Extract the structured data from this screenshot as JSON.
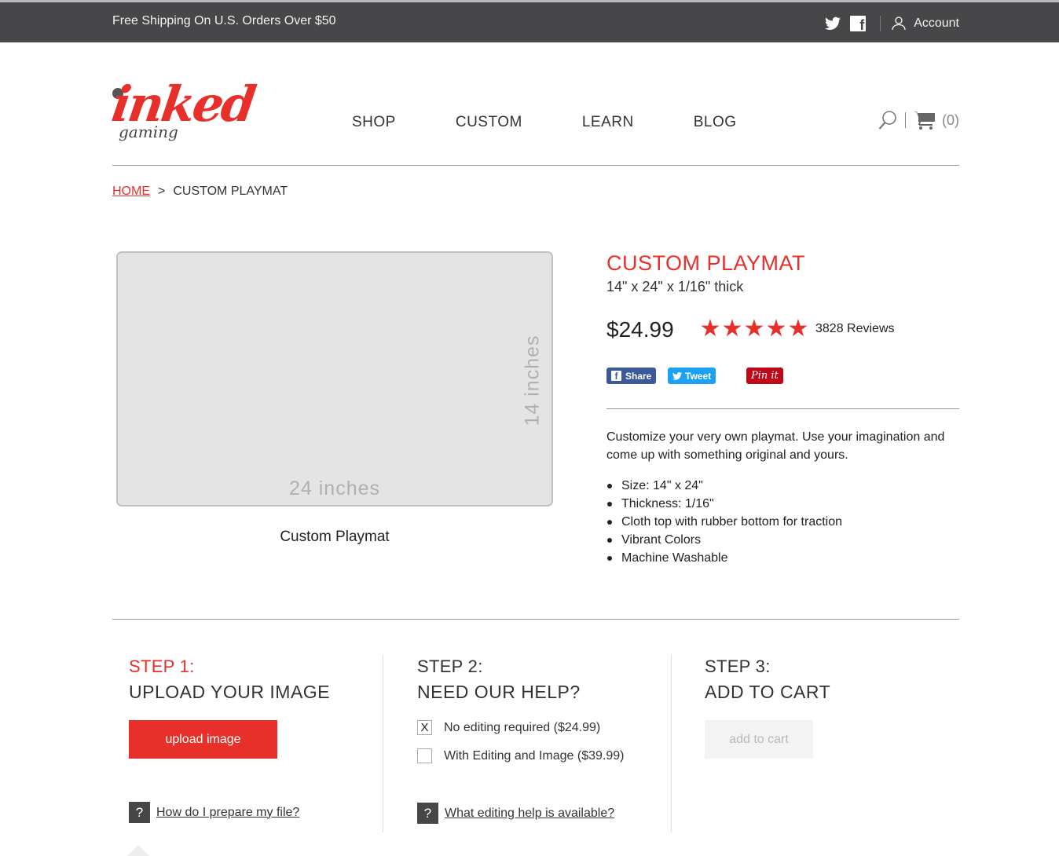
{
  "topbar": {
    "promo": "Free Shipping On U.S. Orders Over $50",
    "account_label": "Account",
    "icons": [
      "twitter-icon",
      "facebook-icon",
      "user-icon"
    ]
  },
  "logo": {
    "main": "inked",
    "sub": "gaming"
  },
  "nav": {
    "items": [
      "SHOP",
      "CUSTOM",
      "LEARN",
      "BLOG"
    ]
  },
  "cart": {
    "count": "(0)"
  },
  "breadcrumb": {
    "home": "HOME",
    "separator": ">",
    "current": "CUSTOM PLAYMAT"
  },
  "preview": {
    "width_label": "24 inches",
    "height_label": "14 inches",
    "caption": "Custom Playmat"
  },
  "product": {
    "title": "CUSTOM PLAYMAT",
    "subtitle": "14\" x 24\" x 1/16\" thick",
    "price": "$24.99",
    "rating": 5,
    "rating_max": 5,
    "reviews": "3828 Reviews",
    "share": {
      "facebook": "Share",
      "twitter": "Tweet",
      "pinterest": "Pin it"
    },
    "description": "Customize your very own playmat. Use your imagination and come up with something original and yours.",
    "features": [
      "Size: 14\" x 24\"",
      "Thickness: 1/16\"",
      "Cloth top with rubber bottom for traction",
      "Vibrant Colors",
      "Machine Washable"
    ]
  },
  "steps": [
    {
      "num": "STEP 1:",
      "title": "UPLOAD YOUR IMAGE",
      "button": "upload image",
      "help": "How do I prepare my file?"
    },
    {
      "num": "STEP 2:",
      "title": "NEED OUR HELP?",
      "options": [
        {
          "label": "No editing required ($24.99)",
          "checked": true,
          "mark": "X"
        },
        {
          "label": "With Editing and Image ($39.99)",
          "checked": false,
          "mark": ""
        }
      ],
      "help": "What editing help is available?"
    },
    {
      "num": "STEP 3:",
      "title": "ADD TO CART",
      "button": "add to cart"
    }
  ],
  "colors": {
    "accent": "#e8302a",
    "topbar": "#474749"
  }
}
